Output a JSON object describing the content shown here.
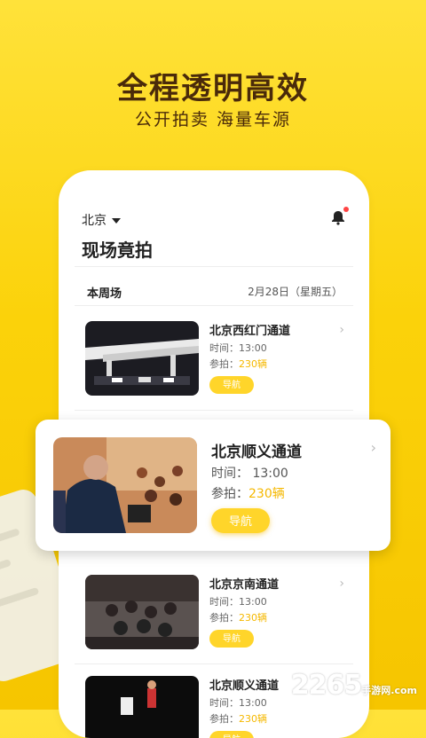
{
  "hero": {
    "title": "全程透明高效",
    "subtitle": "公开拍卖  海量车源"
  },
  "header": {
    "location": "北京",
    "page_title": "现场竟拍",
    "bell_icon": "bell-icon"
  },
  "section": {
    "label": "本周场",
    "date": "2月28日（星期五）"
  },
  "cards": [
    {
      "name": "北京西红门通道",
      "time": "时间：13:00",
      "count_label": "参拍：",
      "count": "230辆",
      "button": "导航"
    },
    {
      "name": "北京京南通道",
      "time": "时间：13:00",
      "count_label": "参拍：",
      "count": "230辆",
      "button": "导航"
    },
    {
      "name": "北京顺义通道",
      "time": "时间：13:00",
      "count_label": "参拍：",
      "count": "230辆",
      "button": "导航"
    }
  ],
  "feature": {
    "name": "北京顺义通道",
    "time": "时间：  13:00",
    "count_label": "参拍：",
    "count": "230辆",
    "button": "导航"
  },
  "watermark": {
    "main": "2265",
    "suffix": "手游网",
    "url": ".com"
  },
  "colors": {
    "accent": "#ffd52a",
    "highlight": "#f5b800",
    "title_brown": "#4a2a0a"
  }
}
